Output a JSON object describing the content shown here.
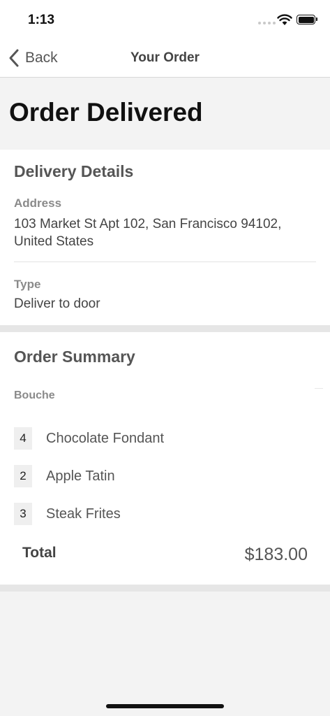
{
  "status_bar": {
    "time": "1:13"
  },
  "nav": {
    "back_label": "Back",
    "title": "Your Order"
  },
  "header": {
    "title": "Order Delivered"
  },
  "delivery": {
    "section_title": "Delivery Details",
    "address_label": "Address",
    "address_value": "103 Market St Apt 102, San Francisco 94102, United States",
    "type_label": "Type",
    "type_value": "Deliver to door"
  },
  "summary": {
    "section_title": "Order Summary",
    "restaurant": "Bouche",
    "items": [
      {
        "qty": "4",
        "name": "Chocolate Fondant"
      },
      {
        "qty": "2",
        "name": "Apple Tatin"
      },
      {
        "qty": "3",
        "name": "Steak Frites"
      }
    ],
    "total_label": "Total",
    "total_amount": "$183.00"
  }
}
